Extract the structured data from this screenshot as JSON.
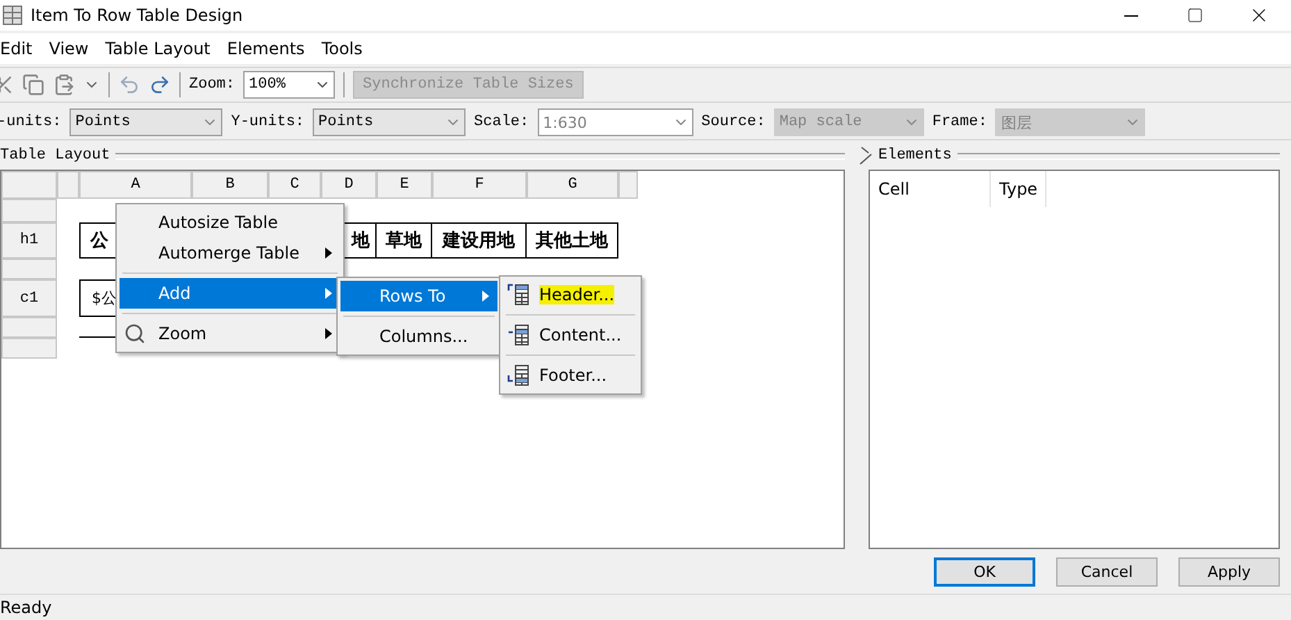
{
  "window": {
    "title": "Item To Row Table Design"
  },
  "menu_bar": [
    "Edit",
    "View",
    "Table Layout",
    "Elements",
    "Tools"
  ],
  "toolbar": {
    "zoom_label": "Zoom:",
    "zoom_value": "100%",
    "sync_button": {
      "label": "Synchronize Table Sizes",
      "disabled": true
    }
  },
  "units_bar": [
    {
      "label": "-units:",
      "value": "Points",
      "disabled": false
    },
    {
      "label": "Y-units:",
      "value": "Points",
      "disabled": false
    },
    {
      "label": "Scale:",
      "value": "1:630",
      "disabled": true
    },
    {
      "label": "Source:",
      "value": "Map scale",
      "disabled": true
    },
    {
      "label": "Frame:",
      "value": "图层",
      "disabled": true
    }
  ],
  "table_layout": {
    "title": "Table Layout",
    "columns": [
      "A",
      "B",
      "C",
      "D",
      "E",
      "F",
      "G"
    ],
    "row_headers": [
      "h1",
      "c1"
    ],
    "header_cells": [
      {
        "text": "公"
      },
      {},
      {},
      {
        "text": "地"
      },
      {
        "text": "草地"
      },
      {
        "text": "建设用地"
      },
      {
        "text": "其他土地"
      }
    ],
    "content_cells": [
      {
        "text": "$公"
      }
    ]
  },
  "context_menu": [
    {
      "kind": "item",
      "label": "Autosize Table",
      "submenu": false,
      "selected": false,
      "has_icon": false
    },
    {
      "kind": "item",
      "label": "Automerge Table",
      "submenu": true,
      "selected": false,
      "has_icon": false
    },
    {
      "kind": "separator"
    },
    {
      "kind": "item",
      "label": "Add",
      "submenu": true,
      "selected": true,
      "has_icon": false
    },
    {
      "kind": "separator"
    },
    {
      "kind": "item",
      "label": "Zoom",
      "submenu": true,
      "selected": false,
      "has_icon": true
    }
  ],
  "add_submenu": [
    {
      "kind": "item",
      "label": "Rows To",
      "submenu": true,
      "selected": true
    },
    {
      "kind": "separator"
    },
    {
      "kind": "item",
      "label": "Columns...",
      "submenu": false,
      "selected": false
    }
  ],
  "rows_submenu": [
    {
      "label": "Header...",
      "highlighted": true
    },
    {
      "label": "Content...",
      "highlighted": false
    },
    {
      "label": "Footer...",
      "highlighted": false
    }
  ],
  "elements": {
    "title": "Elements",
    "columns": [
      "Cell",
      "Type"
    ]
  },
  "buttons": [
    {
      "label": "OK",
      "default": true
    },
    {
      "label": "Cancel",
      "default": false
    },
    {
      "label": "Apply",
      "default": false
    }
  ],
  "status_bar": "Ready"
}
